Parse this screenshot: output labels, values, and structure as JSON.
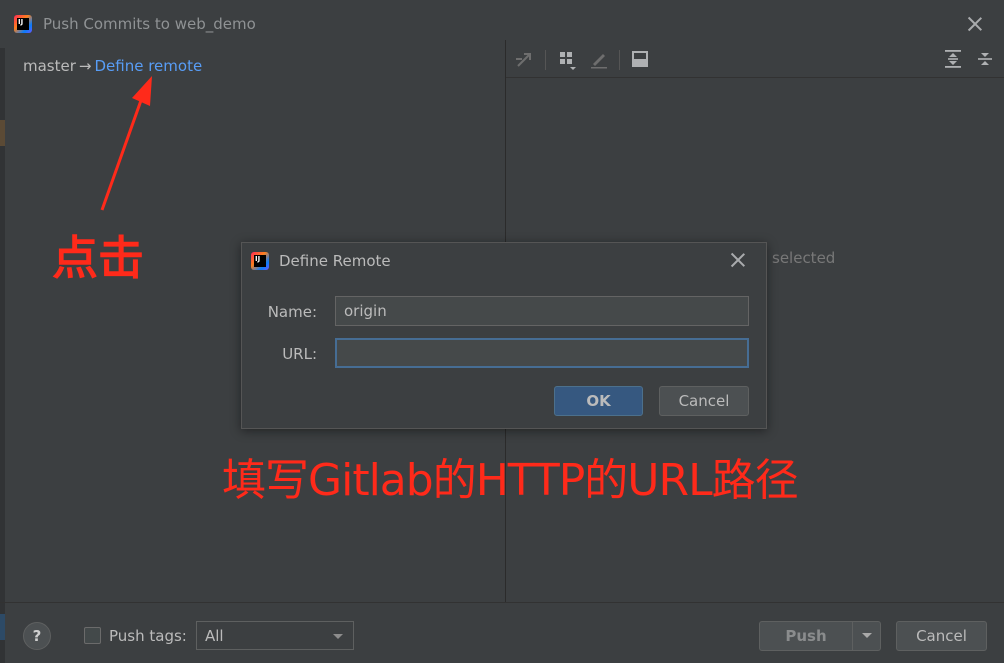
{
  "window": {
    "title": "Push Commits to web_demo",
    "logo_text": "IJ"
  },
  "branch": {
    "local": "master",
    "arrow": "→",
    "remote_link": "Define remote"
  },
  "right_panel": {
    "status_text": "selected"
  },
  "bottom": {
    "help_label": "?",
    "push_tags_label": "Push tags:",
    "push_tags_selected": "All",
    "push_button": "Push",
    "cancel_button": "Cancel"
  },
  "dialog": {
    "title": "Define Remote",
    "name_label": "Name:",
    "name_value": "origin",
    "url_label": "URL:",
    "url_value": "",
    "ok_button": "OK",
    "cancel_button": "Cancel"
  },
  "annotations": {
    "click_note": "点击",
    "url_note": "填写Gitlab的HTTP的URL路径",
    "color": "#ff2a1a"
  },
  "icons": [
    "ij-logo-icon",
    "close-icon",
    "fetch-icon",
    "group-icon",
    "edit-icon",
    "preview-icon",
    "expand-all-icon",
    "collapse-all-icon",
    "chevron-down-icon"
  ]
}
